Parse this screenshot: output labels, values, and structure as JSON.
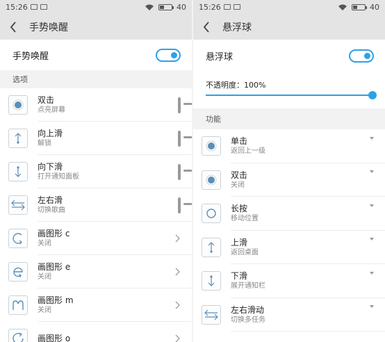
{
  "left": {
    "status": {
      "time": "15:26",
      "battery": "40",
      "battery_level": 0.4
    },
    "title": "手势唤醒",
    "main_toggle": {
      "label": "手势唤醒",
      "on": true
    },
    "section_label": "选项",
    "items": [
      {
        "title": "双击",
        "sub": "点亮屏幕",
        "control": "switch-off",
        "icon": "double-tap-icon"
      },
      {
        "title": "向上滑",
        "sub": "解锁",
        "control": "switch-off",
        "icon": "swipe-up-icon"
      },
      {
        "title": "向下滑",
        "sub": "打开通知面板",
        "control": "switch-off",
        "icon": "swipe-down-icon"
      },
      {
        "title": "左右滑",
        "sub": "切换歌曲",
        "control": "switch-off",
        "icon": "swipe-horizontal-icon"
      },
      {
        "title": "画图形 c",
        "sub": "关闭",
        "control": "chevron",
        "icon": "draw-c-icon"
      },
      {
        "title": "画图形 e",
        "sub": "关闭",
        "control": "chevron",
        "icon": "draw-e-icon"
      },
      {
        "title": "画图形 m",
        "sub": "关闭",
        "control": "chevron",
        "icon": "draw-m-icon"
      },
      {
        "title": "画图形 o",
        "sub": "",
        "control": "chevron",
        "icon": "draw-o-icon"
      }
    ]
  },
  "right": {
    "status": {
      "time": "15:26",
      "battery": "40",
      "battery_level": 0.4
    },
    "title": "悬浮球",
    "main_toggle": {
      "label": "悬浮球",
      "on": true
    },
    "opacity": {
      "label": "不透明度：100%",
      "value": 1.0
    },
    "section_label": "功能",
    "items": [
      {
        "title": "单击",
        "sub": "返回上一级",
        "icon": "single-tap-icon"
      },
      {
        "title": "双击",
        "sub": "关闭",
        "icon": "double-tap-icon"
      },
      {
        "title": "长按",
        "sub": "移动位置",
        "icon": "long-press-icon"
      },
      {
        "title": "上滑",
        "sub": "返回桌面",
        "icon": "swipe-up-icon"
      },
      {
        "title": "下滑",
        "sub": "展开通知栏",
        "icon": "swipe-down-icon"
      },
      {
        "title": "左右滑动",
        "sub": "切换多任务",
        "icon": "swipe-horizontal-icon"
      }
    ]
  },
  "colors": {
    "accent": "#2da1e6",
    "bar": "#e4e4e4",
    "section": "#f2f2f2",
    "icon_stroke": "#5a8fb8"
  }
}
